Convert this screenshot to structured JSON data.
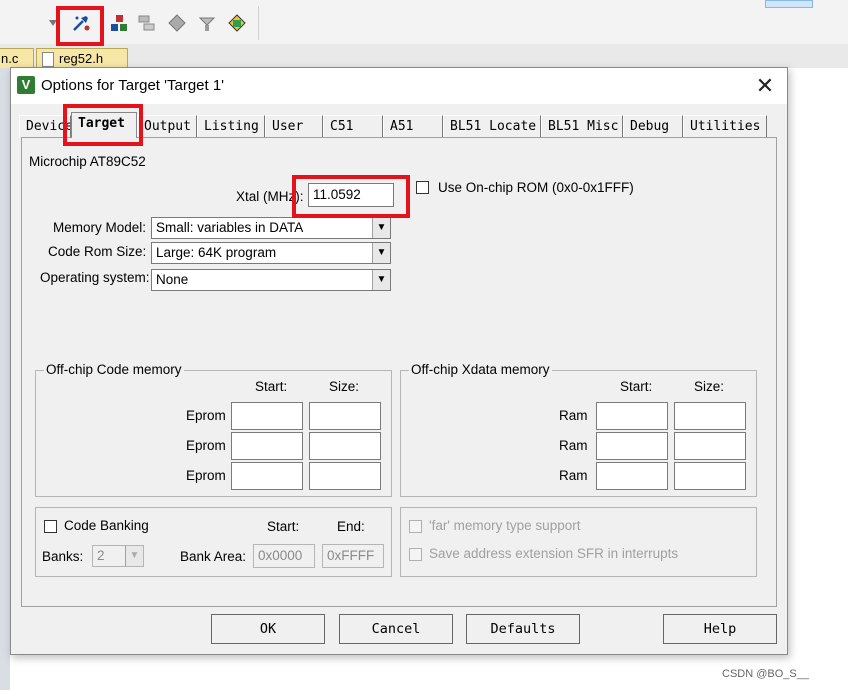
{
  "dialog": {
    "title": "Options for Target 'Target 1'",
    "app_icon_letter": "V",
    "close_glyph": "✕",
    "tabs": [
      {
        "label": "Device"
      },
      {
        "label": "Target"
      },
      {
        "label": "Output"
      },
      {
        "label": "Listing"
      },
      {
        "label": "User"
      },
      {
        "label": "C51"
      },
      {
        "label": "A51"
      },
      {
        "label": "BL51 Locate"
      },
      {
        "label": "BL51 Misc"
      },
      {
        "label": "Debug"
      },
      {
        "label": "Utilities"
      }
    ],
    "active_tab": "Target"
  },
  "ide": {
    "file_tabs": [
      {
        "label": "n.c"
      },
      {
        "label": "reg52.h"
      }
    ],
    "toolbar_icons": [
      "options-for-target-icon",
      "manage-project-icon",
      "multi-project-icon",
      "select-packs-icon",
      "pack-installer-icon",
      "manage-components-icon"
    ]
  },
  "target": {
    "device_name": "Microchip AT89C52",
    "xtal_label": "Xtal (MHz):",
    "xtal_value": "11.0592",
    "onchip_rom_label": "Use On-chip ROM (0x0-0x1FFF)",
    "memory_model_label": "Memory Model:",
    "memory_model_value": "Small: variables in DATA",
    "code_rom_label": "Code Rom Size:",
    "code_rom_value": "Large: 64K program",
    "os_label": "Operating system:",
    "os_value": "None"
  },
  "offchip_code": {
    "title": "Off-chip Code memory",
    "start_header": "Start:",
    "size_header": "Size:",
    "rows": [
      {
        "label": "Eprom",
        "start": "",
        "size": ""
      },
      {
        "label": "Eprom",
        "start": "",
        "size": ""
      },
      {
        "label": "Eprom",
        "start": "",
        "size": ""
      }
    ]
  },
  "offchip_xdata": {
    "title": "Off-chip Xdata memory",
    "start_header": "Start:",
    "size_header": "Size:",
    "rows": [
      {
        "label": "Ram",
        "start": "",
        "size": ""
      },
      {
        "label": "Ram",
        "start": "",
        "size": ""
      },
      {
        "label": "Ram",
        "start": "",
        "size": ""
      }
    ]
  },
  "banking": {
    "code_banking_label": "Code Banking",
    "banks_label": "Banks:",
    "banks_value": "2",
    "start_header": "Start:",
    "end_header": "End:",
    "bank_area_label": "Bank Area:",
    "bank_area_start": "0x0000",
    "bank_area_end": "0xFFFF",
    "far_memory_label": "'far' memory type support",
    "save_sfr_label": "Save address extension SFR in interrupts"
  },
  "buttons": {
    "ok": "OK",
    "cancel": "Cancel",
    "defaults": "Defaults",
    "help": "Help"
  },
  "watermark": "CSDN @BO_S__",
  "colors": {
    "highlight_red": "#e4121a",
    "file_tab_yellow": "#f6e7a6"
  }
}
